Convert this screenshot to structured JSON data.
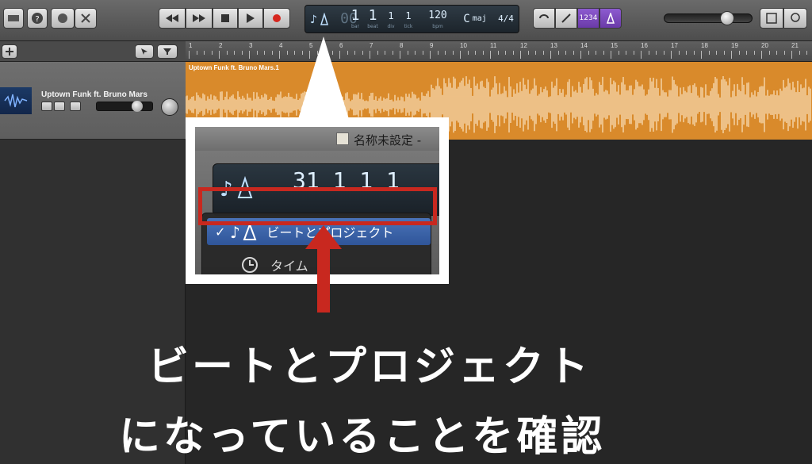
{
  "lcd": {
    "bar": "1",
    "beat": "1",
    "div": "1",
    "tick": "1",
    "bar_label": "bar",
    "beat_label": "beat",
    "div_label": "div",
    "tick_label": "tick",
    "tempo": "120",
    "tempo_label": "bpm",
    "key": "C",
    "key_mode": "maj",
    "signature": "4/4"
  },
  "count_in": "1234",
  "track": {
    "name": "Uptown Funk ft. Bruno Mars"
  },
  "region": {
    "title": "Uptown Funk ft. Bruno Mars.1"
  },
  "ruler": {
    "bars": [
      "1",
      "2",
      "3",
      "4",
      "5",
      "6",
      "7",
      "8",
      "9",
      "10",
      "11",
      "12",
      "13",
      "14",
      "15",
      "16",
      "17",
      "18",
      "19",
      "20",
      "21"
    ]
  },
  "zoom": {
    "window_title": "名称未設定 -",
    "lcd_value": "31 1 1 1",
    "menu": {
      "selected_check": "✓",
      "item_beat": "ビートとプロジェクト",
      "item_time": "タイム"
    }
  },
  "caption": {
    "line1": "ビートとプロジェクト",
    "line2": "になっていることを確認"
  },
  "colors": {
    "region": "#d98a2b",
    "highlight": "#c8281f",
    "menu_selected": "#3b63a8"
  }
}
